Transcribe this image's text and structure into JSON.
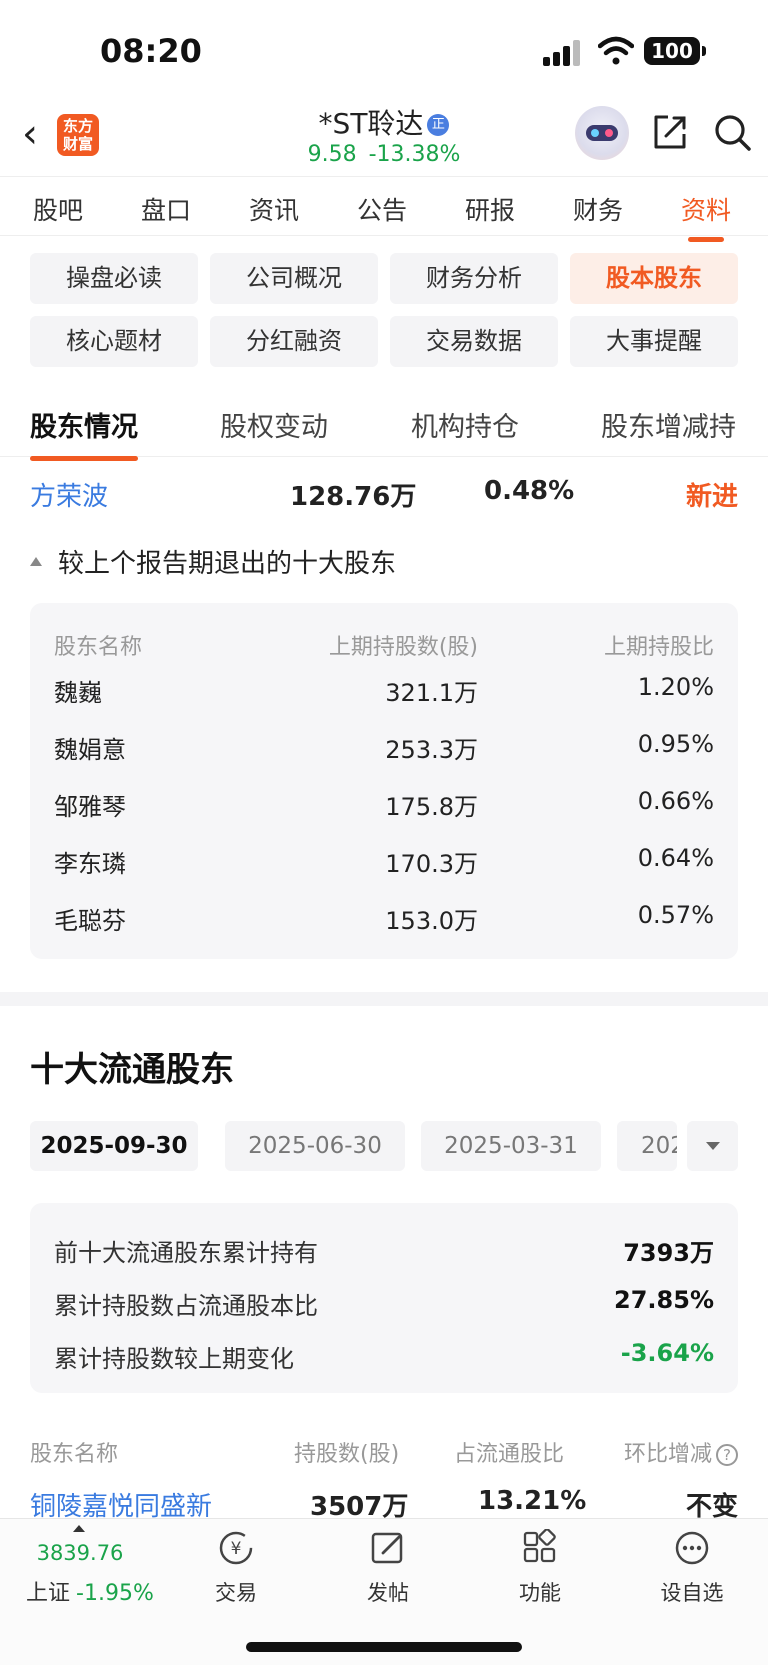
{
  "status": {
    "time": "08:20",
    "battery": "100"
  },
  "header": {
    "logo": "东方\n财富",
    "stock_name": "*ST聆达",
    "badge": "正",
    "price": "9.58",
    "change": "-13.38%"
  },
  "main_tabs": [
    "股吧",
    "盘口",
    "资讯",
    "公告",
    "研报",
    "财务",
    "资料"
  ],
  "sub_buttons": [
    "操盘必读",
    "公司概况",
    "财务分析",
    "股本股东",
    "核心题材",
    "分红融资",
    "交易数据",
    "大事提醒"
  ],
  "section_tabs": [
    "股东情况",
    "股权变动",
    "机构持仓",
    "股东增减持"
  ],
  "new_holder": {
    "name": "方荣波",
    "shares": "128.76万",
    "pct": "0.48%",
    "status": "新进"
  },
  "exit_section": {
    "label": "较上个报告期退出的十大股东",
    "headers": [
      "股东名称",
      "上期持股数(股)",
      "上期持股比"
    ],
    "rows": [
      {
        "name": "魏巍",
        "shares": "321.1万",
        "pct": "1.20%"
      },
      {
        "name": "魏娟意",
        "shares": "253.3万",
        "pct": "0.95%"
      },
      {
        "name": "邹雅琴",
        "shares": "175.8万",
        "pct": "0.66%"
      },
      {
        "name": "李东璘",
        "shares": "170.3万",
        "pct": "0.64%"
      },
      {
        "name": "毛聪芬",
        "shares": "153.0万",
        "pct": "0.57%"
      }
    ]
  },
  "float_section": {
    "title": "十大流通股东",
    "dates": [
      "2025-09-30",
      "2025-06-30",
      "2025-03-31",
      "202"
    ],
    "summary": [
      {
        "label": "前十大流通股东累计持有",
        "value": "7393万"
      },
      {
        "label": "累计持股数占流通股本比",
        "value": "27.85%"
      },
      {
        "label": "累计持股数较上期变化",
        "value": "-3.64%"
      }
    ],
    "headers": [
      "股东名称",
      "持股数(股)",
      "占流通股比",
      "环比增减"
    ],
    "rows": [
      {
        "name": "铜陵嘉悦同盛新",
        "shares": "3507万",
        "pct": "13.21%",
        "change": "不变"
      }
    ]
  },
  "bottom_bar": {
    "index_value": "3839.76",
    "index_name": "上证",
    "index_change": "-1.95%",
    "items": [
      "交易",
      "发帖",
      "功能",
      "设自选"
    ]
  },
  "colors": {
    "accent": "#f15a22",
    "down": "#1aa34a",
    "link": "#3a7be0"
  }
}
